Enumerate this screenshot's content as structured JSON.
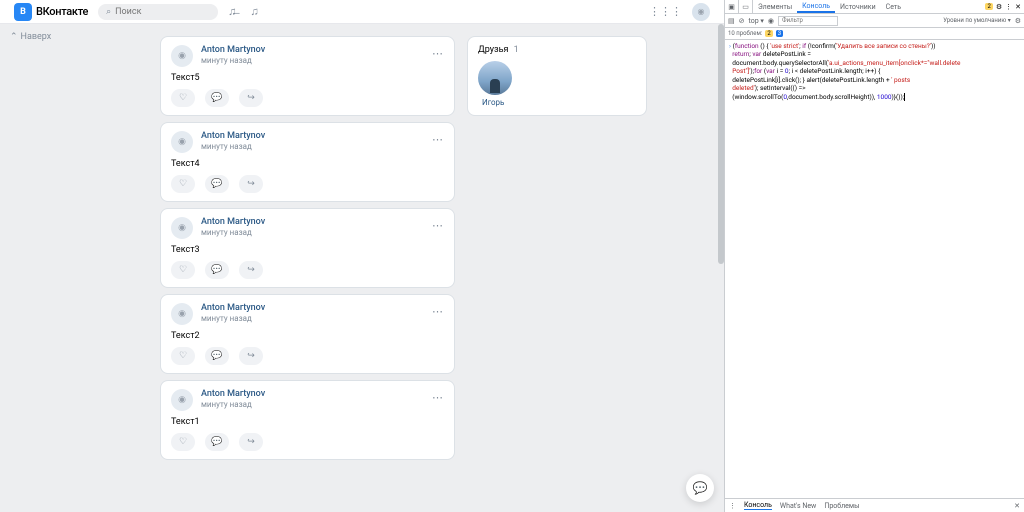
{
  "header": {
    "logo": "ВКонтакте",
    "search_placeholder": "Поиск"
  },
  "nav_back": "Наверх",
  "posts": [
    {
      "author": "Anton Martynov",
      "time": "минуту назад",
      "text": "Текст5"
    },
    {
      "author": "Anton Martynov",
      "time": "минуту назад",
      "text": "Текст4"
    },
    {
      "author": "Anton Martynov",
      "time": "минуту назад",
      "text": "Текст3"
    },
    {
      "author": "Anton Martynov",
      "time": "минуту назад",
      "text": "Текст2"
    },
    {
      "author": "Anton Martynov",
      "time": "минуту назад",
      "text": "Текст1"
    }
  ],
  "friends": {
    "title": "Друзья",
    "count": "1",
    "name": "Игорь"
  },
  "devtools": {
    "tabs": [
      "Элементы",
      "Консоль",
      "Источники",
      "Сеть"
    ],
    "badge_count": "2",
    "toolbar": {
      "top": "top ▾",
      "eye": "◉",
      "filter": "Фильтр",
      "levels": "Уровни по умолчанию ▾"
    },
    "issues": {
      "label": "10 проблем:",
      "y": "2",
      "b": "3"
    },
    "code": "(function () { 'use strict'; if (!confirm('Удалить все записи со стены?')) return; var deletePostLink = document.body.querySelectorAll('a.ui_actions_menu_item[onclick*=\"wall.deletePost\"]');for (var i = 0; i < deletePostLink.length; i++) { deletePostLink[i].click(); } alert(deletePostLink.length + ' posts deleted'); setInterval(() => (window.scrollTo(0,document.body.scrollHeight)), 1000)}());",
    "footer": [
      "Консоль",
      "What's New",
      "Проблемы"
    ]
  }
}
